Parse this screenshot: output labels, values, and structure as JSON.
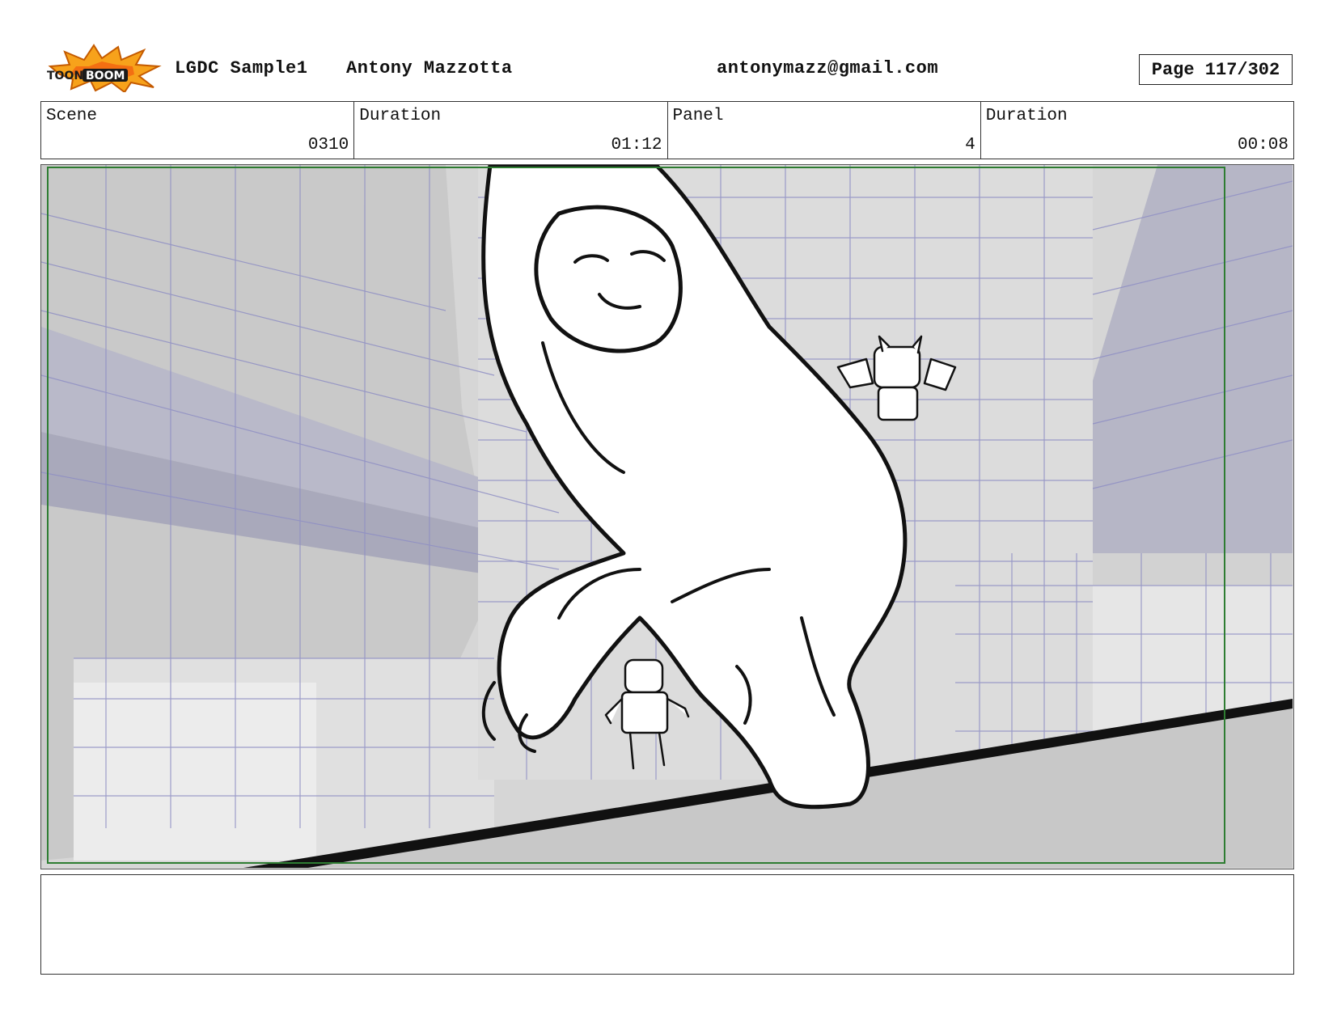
{
  "header": {
    "logo_text": "TOONBOOM",
    "project": "LGDC Sample1",
    "artist": "Antony Mazzotta",
    "email": "antonymazz@gmail.com",
    "page_label": "Page 117/302"
  },
  "info": {
    "scene_label": "Scene",
    "scene_value": "0310",
    "scene_duration_label": "Duration",
    "scene_duration_value": "01:12",
    "panel_label": "Panel",
    "panel_value": "4",
    "panel_duration_label": "Duration",
    "panel_duration_value": "00:08"
  },
  "panel": {
    "description": "",
    "safe_frame_color": "#2e7d32",
    "layout_line_color": "#8f8fc4",
    "ink_color": "#111111"
  },
  "notes": {
    "text": ""
  }
}
